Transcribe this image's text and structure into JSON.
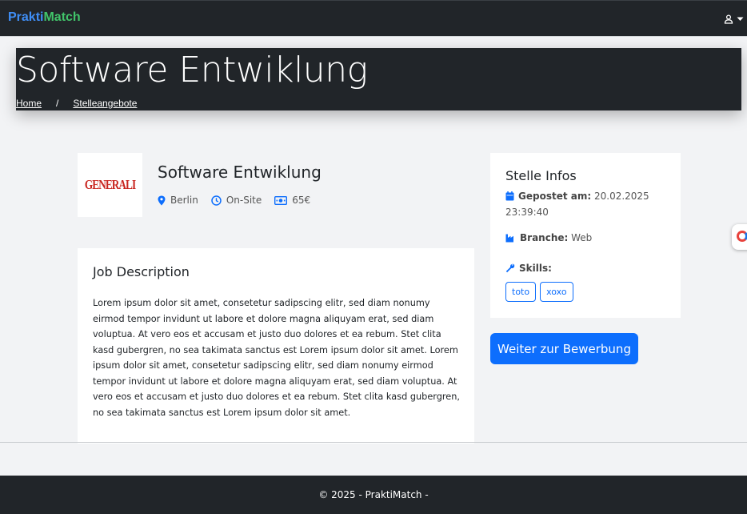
{
  "navbar": {
    "brand_part1": "Prakti",
    "brand_part2": "Match",
    "user_icon": "user-icon",
    "dropdown_icon": "caret-down-icon"
  },
  "hero": {
    "title": "Software Entwiklung",
    "breadcrumb": [
      {
        "label": "Home"
      },
      {
        "label": "Stelleangebote"
      }
    ],
    "separator": "/"
  },
  "job": {
    "company_logo_text": "GENERALI",
    "title": "Software Entwiklung",
    "location": "Berlin",
    "work_mode": "On-Site",
    "salary": "65€",
    "location_icon": "map-pin-icon",
    "mode_icon": "clock-icon",
    "salary_icon": "money-icon"
  },
  "description": {
    "heading": "Job Description",
    "text": "Lorem ipsum dolor sit amet, consetetur sadipscing elitr, sed diam nonumy eirmod tempor invidunt ut labore et dolore magna aliquyam erat, sed diam voluptua. At vero eos et accusam et justo duo dolores et ea rebum. Stet clita kasd gubergren, no sea takimata sanctus est Lorem ipsum dolor sit amet. Lorem ipsum dolor sit amet, consetetur sadipscing elitr, sed diam nonumy eirmod tempor invidunt ut labore et dolore magna aliquyam erat, sed diam voluptua. At vero eos et accusam et justo duo dolores et ea rebum. Stet clita kasd gubergren, no sea takimata sanctus est Lorem ipsum dolor sit amet."
  },
  "info": {
    "heading": "Stelle Infos",
    "posted_label": "Gepostet am:",
    "posted_value": "20.02.2025 23:39:40",
    "branch_label": "Branche:",
    "branch_value": "Web",
    "skills_label": "Skills:",
    "skills": [
      "toto",
      "xoxo"
    ],
    "posted_icon": "calendar-icon",
    "branch_icon": "industry-icon",
    "skills_icon": "wrench-icon"
  },
  "apply_button": "Weiter zur Bewerbung",
  "footer": {
    "text": "© 2025 - PraktiMatch -"
  },
  "colors": {
    "dark": "#212529",
    "primary": "#0d6efd",
    "brand_blue": "#3f8ef6",
    "brand_green": "#41c46a",
    "logo_red": "#c8241e"
  }
}
